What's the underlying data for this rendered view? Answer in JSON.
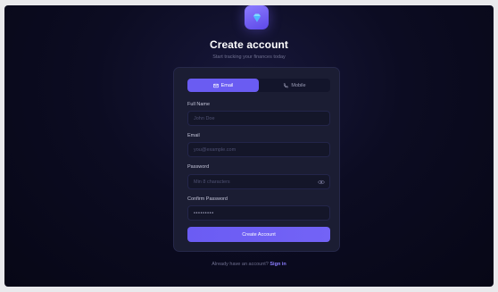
{
  "header": {
    "title": "Create account",
    "subtitle": "Start tracking your finances today"
  },
  "tabs": {
    "email_label": "Email",
    "mobile_label": "Mobile",
    "active": "Email"
  },
  "form": {
    "full_name": {
      "label": "Full Name",
      "placeholder": "John Doe"
    },
    "email": {
      "label": "Email",
      "placeholder": "you@example.com"
    },
    "password": {
      "label": "Password",
      "placeholder": "Min 8 characters"
    },
    "confirm_password": {
      "label": "Confirm Password",
      "value": "•••••••••"
    },
    "submit_label": "Create Account"
  },
  "footer": {
    "prompt": "Already have an account?",
    "link_label": "Sign in"
  },
  "colors": {
    "accent": "#6a5cf2",
    "background": "#0c0c22",
    "card": "#1b1d33"
  },
  "icons": {
    "logo": "gem-icon",
    "email_tab": "mail-icon",
    "mobile_tab": "phone-icon",
    "password_toggle": "eye-icon"
  }
}
